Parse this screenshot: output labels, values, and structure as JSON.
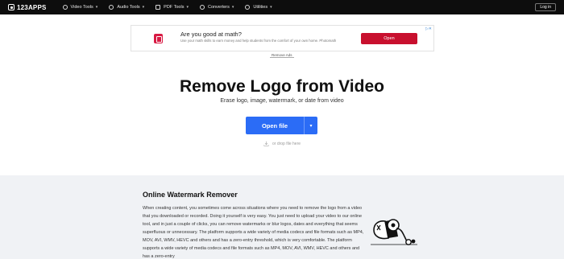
{
  "nav": {
    "brand": "123APPS",
    "items": [
      {
        "label": "Video Tools"
      },
      {
        "label": "Audio Tools"
      },
      {
        "label": "PDF Tools"
      },
      {
        "label": "Converters"
      },
      {
        "label": "Utilities"
      }
    ],
    "login": "Log in"
  },
  "ad": {
    "title": "Are you good at math?",
    "text": "Use your math skills to earn money and help students from the comfort of your own home. Photomath",
    "button": "Open",
    "remove_ads": "Remove Ads"
  },
  "hero": {
    "title": "Remove Logo from Video",
    "subtitle": "Erase logo, image, watermark, or date from video",
    "open_button": "Open file",
    "drop_hint": "or drop file here"
  },
  "article": {
    "heading": "Online Watermark Remover",
    "paragraph": "When creating content, you sometimes come across situations where you need to remove the logo from a video that you downloaded or recorded. Doing it yourself is very easy. You just need to upload your video to our online tool, and in just a couple of clicks, you can remove watermarks or blur logos, dates and everything that seems superfluous or unnecessary. The platform supports a wide variety of media codecs and file formats such as MP4, MOV, AVI, WMV, HEVC and others and has a zero-entry threshold, which is very comfortable. The platform supports a wide variety of media codecs and file formats such as MP4, MOV, AVI, WMV, HEVC and others and has a zero-entry"
  },
  "colors": {
    "nav_bg": "#0d0d0d",
    "primary": "#2b6cf6",
    "ad_button": "#c8102e",
    "lower_bg": "#f0f2f5"
  }
}
